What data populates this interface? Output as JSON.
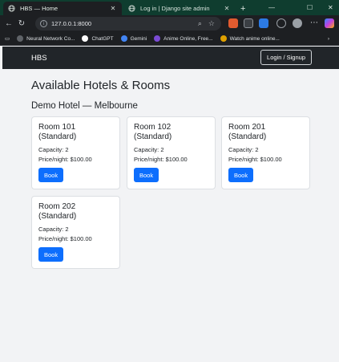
{
  "browser": {
    "tabs": [
      {
        "title": "HBS — Home",
        "active": true
      },
      {
        "title": "Log in | Django site admin",
        "active": false
      }
    ],
    "url": "127.0.0.1:8000",
    "bookmarks": [
      {
        "label": "Neural Network Co...",
        "color": "#5f6368"
      },
      {
        "label": "ChatGPT",
        "color": "#ffffff"
      },
      {
        "label": "Gemini",
        "color": "#4285f4"
      },
      {
        "label": "Anime Online, Free...",
        "color": "#7b4bd4"
      },
      {
        "label": "Watch anime online...",
        "color": "#e0a100"
      }
    ]
  },
  "navbar": {
    "brand": "HBS",
    "login_label": "Login / Signup"
  },
  "page": {
    "title": "Available Hotels & Rooms",
    "hotel": "Demo Hotel — Melbourne",
    "rooms": [
      {
        "name": "Room 101 (Standard)",
        "capacity": "Capacity: 2",
        "price": "Price/night: $100.00",
        "book": "Book"
      },
      {
        "name": "Room 102 (Standard)",
        "capacity": "Capacity: 2",
        "price": "Price/night: $100.00",
        "book": "Book"
      },
      {
        "name": "Room 201 (Standard)",
        "capacity": "Capacity: 2",
        "price": "Price/night: $100.00",
        "book": "Book"
      },
      {
        "name": "Room 202 (Standard)",
        "capacity": "Capacity: 2",
        "price": "Price/night: $100.00",
        "book": "Book"
      }
    ]
  },
  "colors": {
    "navbar_bg": "#212529",
    "primary": "#0d6efd",
    "tabbar_bg": "#0f3d2f"
  }
}
